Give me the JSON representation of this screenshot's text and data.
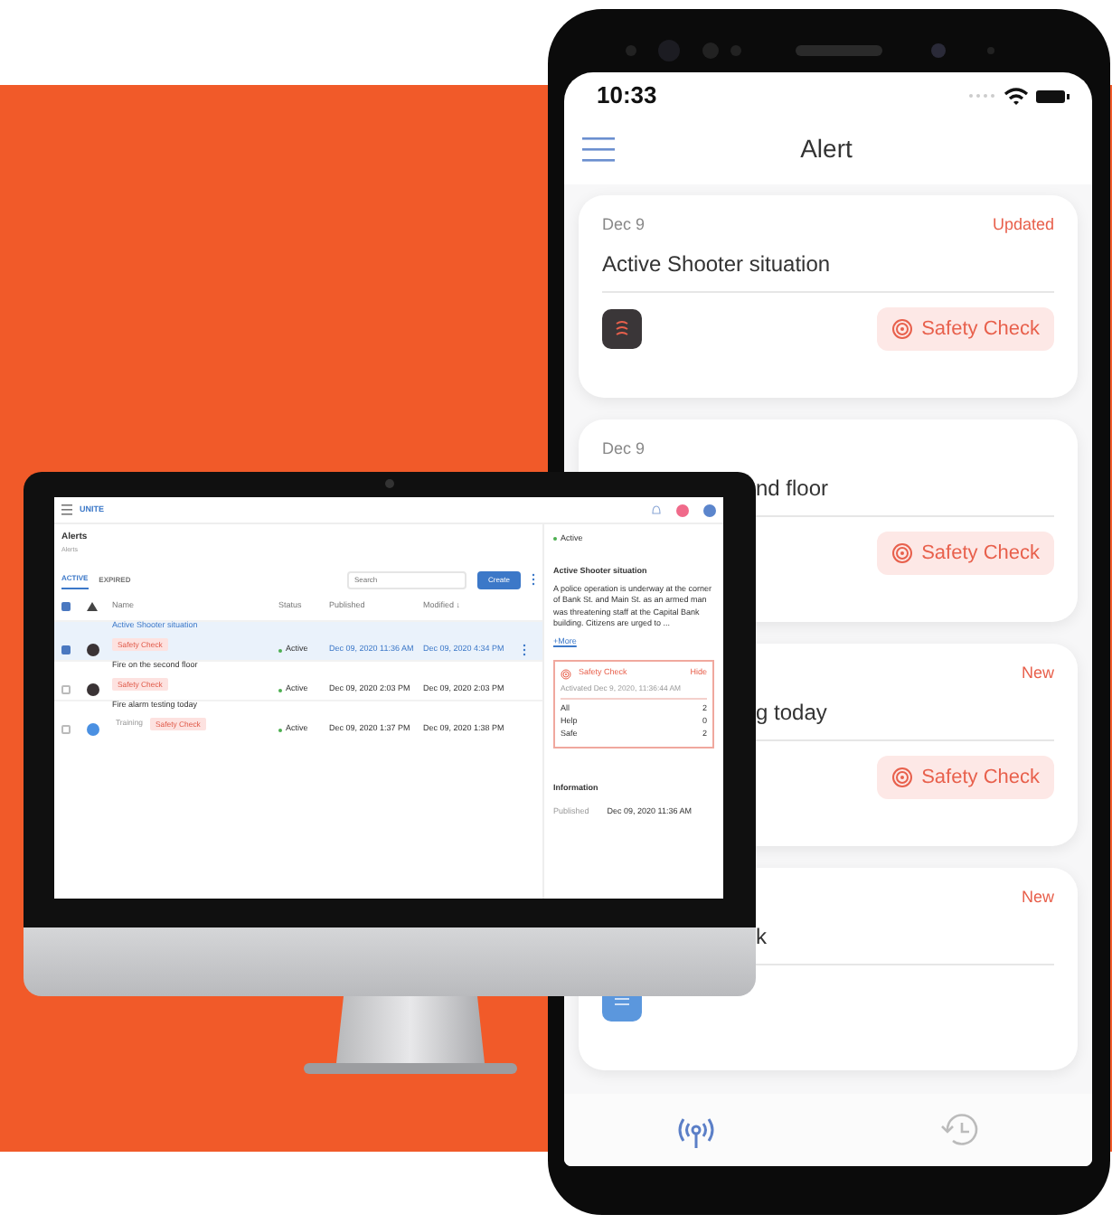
{
  "desktop": {
    "app_name": "UNITE",
    "page_title": "Alerts",
    "page_subtitle": "Alerts",
    "tabs": [
      {
        "label": "ACTIVE",
        "selected": true
      },
      {
        "label": "EXPIRED",
        "selected": false
      }
    ],
    "search": {
      "placeholder": "Search"
    },
    "create_button": "Create",
    "select_all_checked": true,
    "columns": [
      "Name",
      "Status",
      "Published",
      "Modified ↓"
    ],
    "rows": [
      {
        "selected": true,
        "checked": true,
        "color": "#3a3335",
        "name": "Active Shooter situation",
        "tags": [
          {
            "label": "Safety Check",
            "kind": "alert"
          }
        ],
        "status": "Active",
        "published": "Dec 09, 2020 11:36 AM",
        "modified": "Dec 09, 2020 4:34 PM"
      },
      {
        "selected": false,
        "checked": false,
        "color": "#3a3335",
        "name": "Fire on the second floor",
        "tags": [
          {
            "label": "Safety Check",
            "kind": "alert"
          }
        ],
        "status": "Active",
        "published": "Dec 09, 2020 2:03 PM",
        "modified": "Dec 09, 2020 2:03 PM"
      },
      {
        "selected": false,
        "checked": false,
        "color": "#4a90e2",
        "name": "Fire alarm testing today",
        "tags": [
          {
            "label": "Training",
            "kind": "plain"
          },
          {
            "label": "Safety Check",
            "kind": "alert"
          }
        ],
        "status": "Active",
        "published": "Dec 09, 2020 1:37 PM",
        "modified": "Dec 09, 2020 1:38 PM"
      }
    ],
    "detail": {
      "status": "Active",
      "title": "Active Shooter situation",
      "body": "A police operation is underway at the corner of Bank St. and Main St. as an armed man was threatening staff at the Capital Bank building. Citizens are urged to ...",
      "more": "+More",
      "safety_check": {
        "title": "Safety Check",
        "hide": "Hide",
        "activated": "Activated Dec 9, 2020, 11:36:44 AM",
        "counts": [
          {
            "label": "All",
            "value": "2"
          },
          {
            "label": "Help",
            "value": "0"
          },
          {
            "label": "Safe",
            "value": "2"
          }
        ]
      },
      "info_title": "Information",
      "info": [
        {
          "label": "Published",
          "value": "Dec 09, 2020 11:36 AM"
        }
      ]
    }
  },
  "phone": {
    "time": "10:33",
    "title": "Alert",
    "cards": [
      {
        "date": "Dec 9",
        "badge": "Updated",
        "title": "Active Shooter situation",
        "kind": "alarm",
        "action": "Safety Check"
      },
      {
        "date": "Dec 9",
        "title": "nd floor",
        "partly_hidden": true,
        "action": "Safety Check"
      },
      {
        "badge": "New",
        "title": "g today",
        "partly_hidden": true,
        "action": "Safety Check"
      },
      {
        "badge": "New",
        "title": "k",
        "partly_hidden": true,
        "kind": "note"
      }
    ],
    "tabs": [
      {
        "kind": "alerts",
        "selected": true
      },
      {
        "kind": "history",
        "selected": false
      }
    ]
  }
}
